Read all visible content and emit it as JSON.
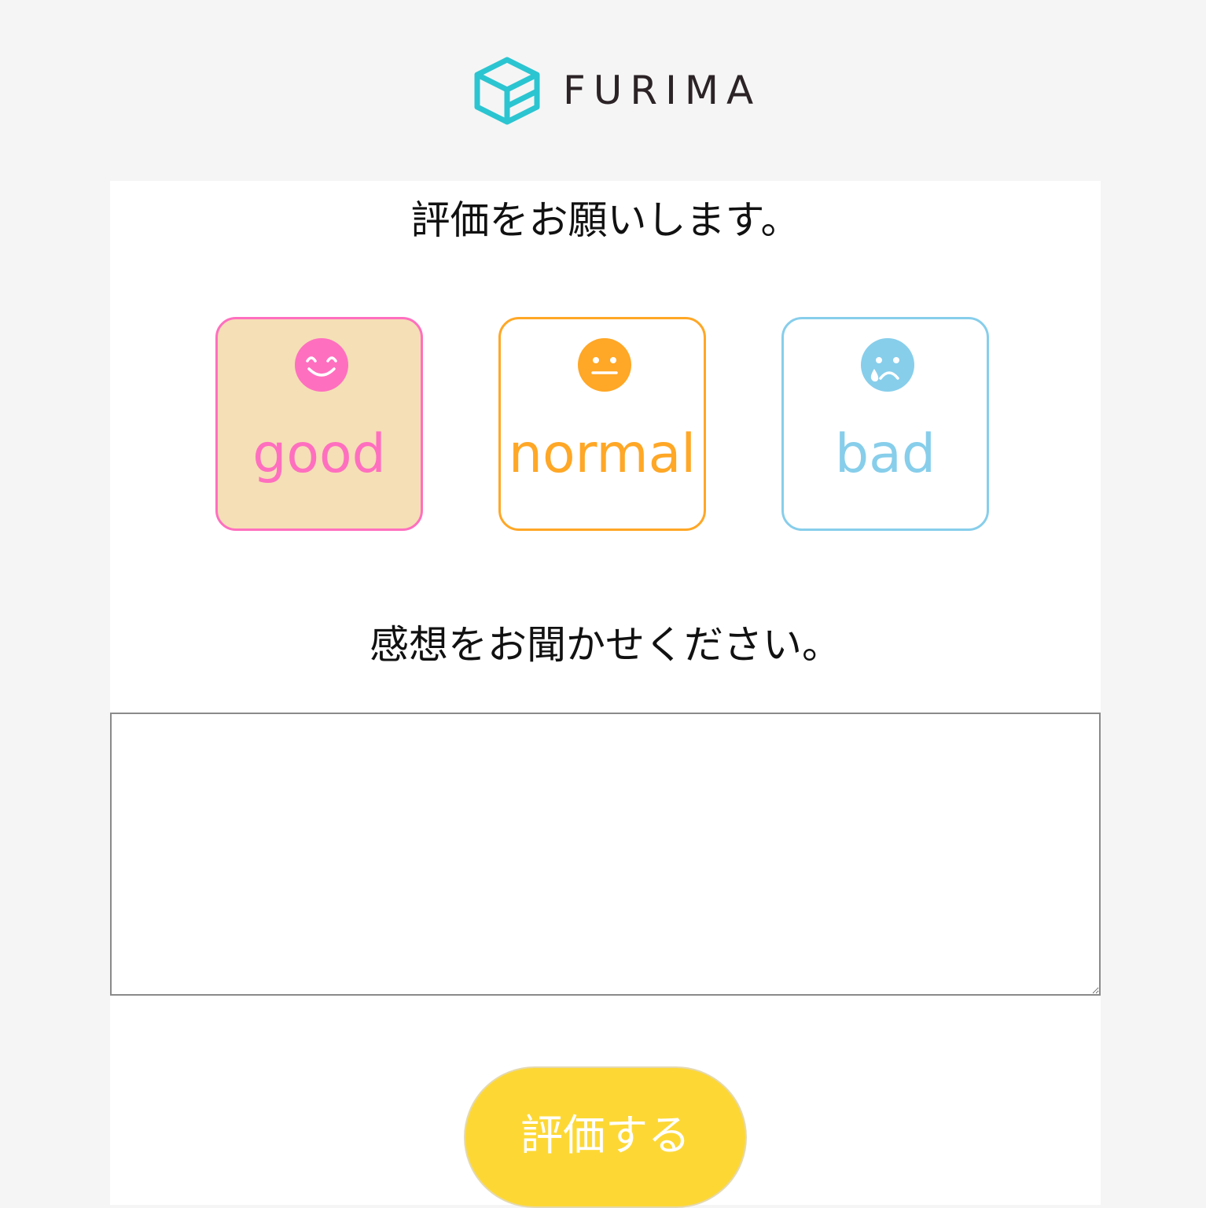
{
  "header": {
    "logo_text": "FURIMA",
    "logo_icon": "box-icon",
    "logo_color": "#2bc5d1"
  },
  "rating": {
    "heading": "評価をお願いします。",
    "options": [
      {
        "label": "good",
        "icon": "smiling-face-icon",
        "color": "#ff6fbf",
        "selected": true
      },
      {
        "label": "normal",
        "icon": "neutral-face-icon",
        "color": "#ffa726",
        "selected": false
      },
      {
        "label": "bad",
        "icon": "crying-face-icon",
        "color": "#87ceeb",
        "selected": false
      }
    ]
  },
  "comment": {
    "heading": "感想をお聞かせください。",
    "value": ""
  },
  "submit": {
    "label": "評価する",
    "color": "#fdd835"
  }
}
